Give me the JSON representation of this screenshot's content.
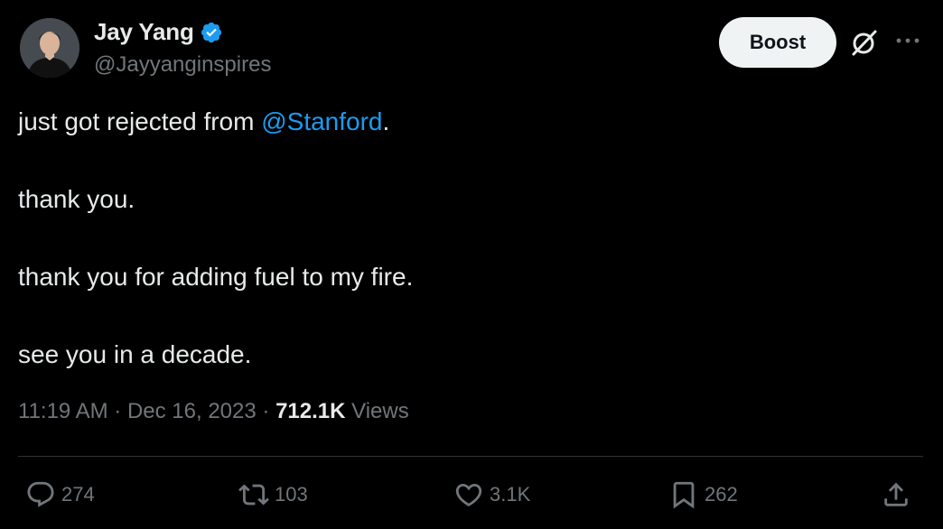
{
  "author": {
    "name": "Jay Yang",
    "handle": "@Jayyanginspires",
    "verified": true,
    "verified_color": "#1d9bf0"
  },
  "header_actions": {
    "boost_label": "Boost",
    "grok_icon": "grok-icon",
    "more_icon": "more-icon"
  },
  "tweet": {
    "line1_prefix": "just got rejected from ",
    "line1_mention": "@Stanford",
    "line1_suffix": ".",
    "line2": "thank you.",
    "line3": "thank you for adding fuel to my fire.",
    "line4": "see you in a decade."
  },
  "meta": {
    "time": "11:19 AM",
    "sep1": " · ",
    "date": "Dec 16, 2023",
    "sep2": " · ",
    "views_count": "712.1K",
    "views_label": " Views"
  },
  "actions": {
    "replies": "274",
    "reposts": "103",
    "likes": "3.1K",
    "bookmarks": "262"
  },
  "colors": {
    "background": "#000000",
    "text": "#e7e9ea",
    "muted": "#71767b",
    "link": "#1d9bf0",
    "divider": "#2f3336"
  }
}
